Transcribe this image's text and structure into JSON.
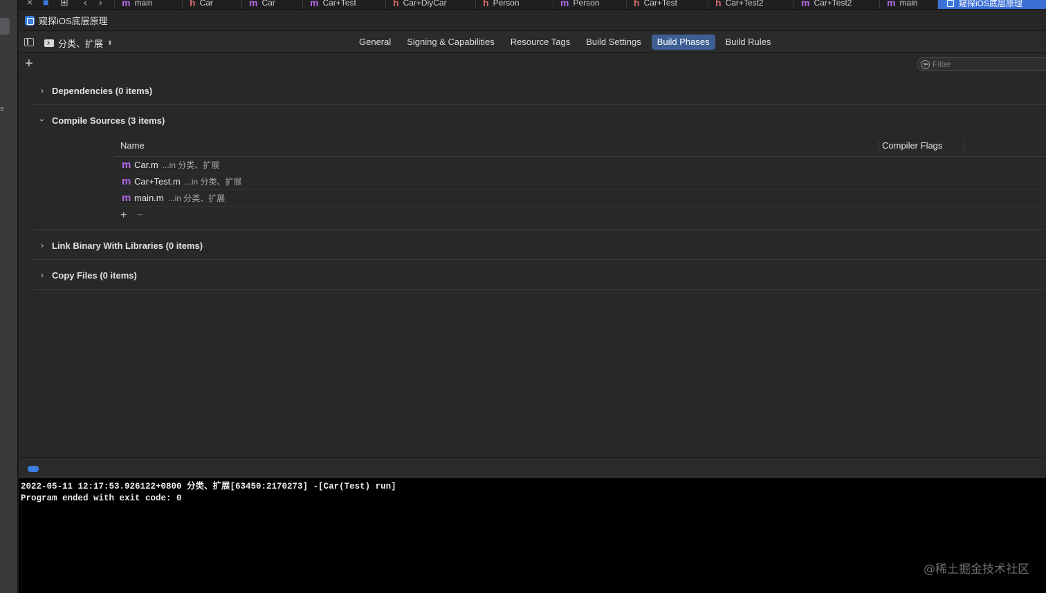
{
  "tabbar": {
    "tabs": [
      {
        "icon": "m",
        "label": "main"
      },
      {
        "icon": "h",
        "label": "Car"
      },
      {
        "icon": "m",
        "label": "Car"
      },
      {
        "icon": "m",
        "label": "Car+Test"
      },
      {
        "icon": "h",
        "label": "Car+DiyCar"
      },
      {
        "icon": "h",
        "label": "Person"
      },
      {
        "icon": "m",
        "label": "Person"
      },
      {
        "icon": "h",
        "label": "Car+Test"
      },
      {
        "icon": "h",
        "label": "Car+Test2"
      },
      {
        "icon": "m",
        "label": "Car+Test2"
      },
      {
        "icon": "m",
        "label": "main"
      },
      {
        "icon": "proj",
        "label": "窥探iOS底层原理"
      }
    ]
  },
  "pathbar": {
    "project_name": "窥探iOS底层原理"
  },
  "editor": {
    "target_name": "分类、扩展",
    "tabs": [
      "General",
      "Signing & Capabilities",
      "Resource Tags",
      "Build Settings",
      "Build Phases",
      "Build Rules"
    ],
    "active_tab": "Build Phases"
  },
  "filter": {
    "placeholder": "Filter"
  },
  "phases": {
    "dependencies": "Dependencies (0 items)",
    "compile_sources": "Compile Sources (3 items)",
    "link_binary": "Link Binary With Libraries (0 items)",
    "copy_files": "Copy Files (0 items)"
  },
  "compile_table": {
    "col_name": "Name",
    "col_flags": "Compiler Flags",
    "rows": [
      {
        "icon": "m",
        "file": "Car.m",
        "location": "...in 分类、扩展"
      },
      {
        "icon": "m",
        "file": "Car+Test.m",
        "location": "...in 分类、扩展"
      },
      {
        "icon": "m",
        "file": "main.m",
        "location": "...in 分类、扩展"
      }
    ]
  },
  "console": {
    "lines": [
      "2022-05-11 12:17:53.926122+0800 分类、扩展[63450:2170273] -[Car(Test) run]",
      "Program ended with exit code: 0"
    ]
  },
  "watermark": "@稀土掘金技术社区",
  "colors": {
    "accent": "#3d5f94",
    "m_file_icon": "#b469e8",
    "h_file_icon": "#d06a6a",
    "console_bg": "#000000"
  }
}
